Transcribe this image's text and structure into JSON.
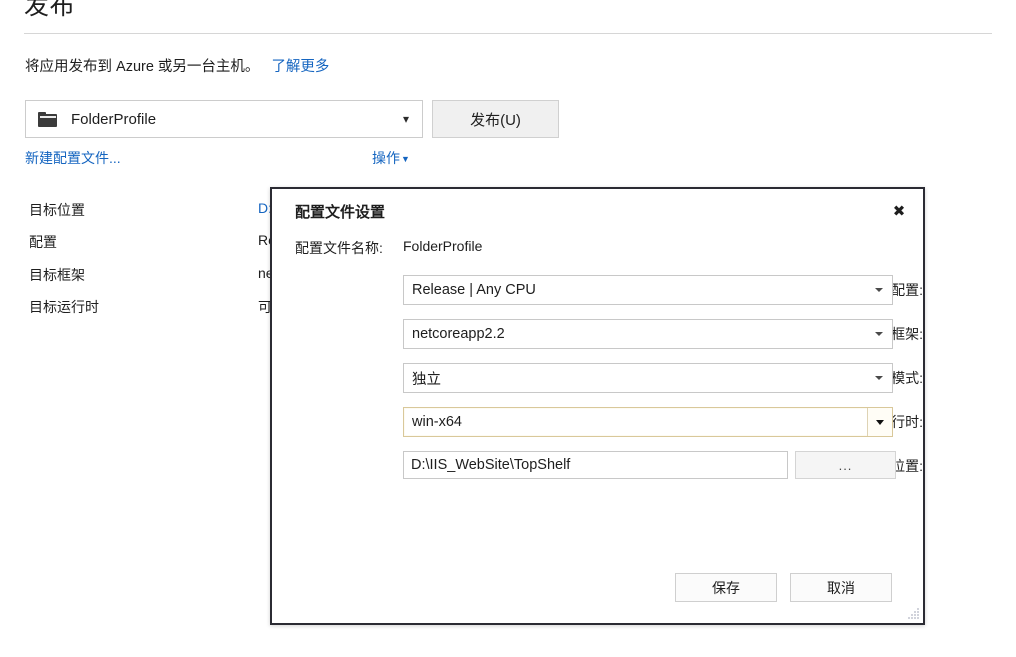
{
  "page": {
    "title": "发布",
    "description": "将应用发布到 Azure 或另一台主机。",
    "learn_more_label": "了解更多",
    "profile_combo": {
      "value": "FolderProfile",
      "icon": "folder-icon",
      "chevron_icon": "chevron-down-icon"
    },
    "publish_button_label": "发布(U)",
    "new_profile_link_label": "新建配置文件...",
    "actions_link_label": "操作",
    "actions_caret_icon": "caret-down-icon",
    "summary_rows": [
      {
        "label": "目标位置",
        "value": "D:",
        "is_link": true
      },
      {
        "label": "配置",
        "value": "Re",
        "is_link": false
      },
      {
        "label": "目标框架",
        "value": "ne",
        "is_link": false
      },
      {
        "label": "目标运行时",
        "value": "可",
        "is_link": false
      }
    ]
  },
  "dialog": {
    "title": "配置文件设置",
    "close_icon": "close-icon",
    "profile_name_label": "配置文件名称:",
    "profile_name_value": "FolderProfile",
    "fields": [
      {
        "label": "配置:",
        "value": "Release | Any CPU",
        "type": "combo",
        "focused": false
      },
      {
        "label": "目标框架:",
        "value": "netcoreapp2.2",
        "type": "combo",
        "focused": false
      },
      {
        "label": "部署模式:",
        "value": "独立",
        "type": "combo",
        "focused": false
      },
      {
        "label": "目标运行时:",
        "value": "win-x64",
        "type": "combo",
        "focused": true
      },
      {
        "label": "目标位置:",
        "value": "D:\\IIS_WebSite\\TopShelf",
        "type": "textbox",
        "focused": false
      }
    ],
    "browse_button_label": "...",
    "save_button_label": "保存",
    "cancel_button_label": "取消",
    "resize_grip_icon": "resize-grip-icon"
  },
  "colors": {
    "link": "#1565c0",
    "dialog_border": "#2b2b33",
    "focus_border": "#d9c89a",
    "button_face": "#f0f0f0"
  }
}
